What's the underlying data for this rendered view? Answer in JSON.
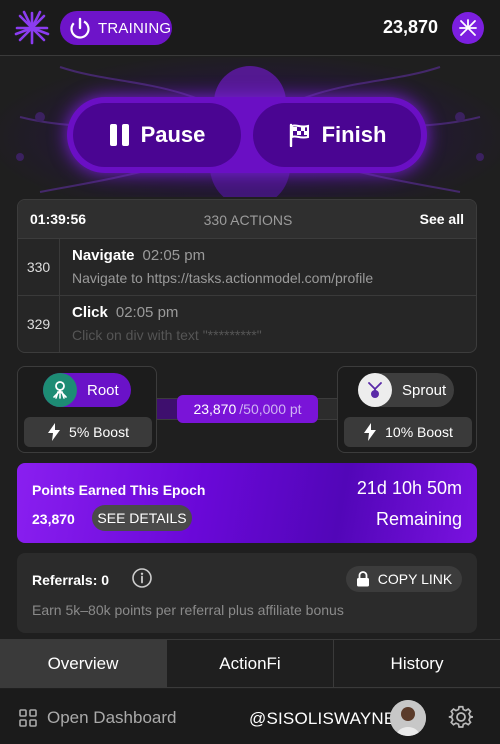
{
  "header": {
    "status_label": "TRAINING",
    "points": "23,870",
    "icons": [
      "logo-icon",
      "power-icon",
      "points-coin-icon"
    ]
  },
  "controls": {
    "pause_label": "Pause",
    "finish_label": "Finish"
  },
  "actions": {
    "timer": "01:39:56",
    "count_label": "330 ACTIONS",
    "see_all": "See all",
    "items": [
      {
        "num": "330",
        "name": "Navigate",
        "time": "02:05 pm",
        "desc": "Navigate to https://tasks.actionmodel.com/profile"
      },
      {
        "num": "329",
        "name": "Click",
        "time": "02:05 pm",
        "desc": "Click on div with text \"*********\""
      }
    ]
  },
  "tiers": {
    "current": {
      "name": "Root",
      "boost": "5% Boost"
    },
    "next": {
      "name": "Sprout",
      "boost": "10% Boost"
    },
    "progress": {
      "value_label": "23,870",
      "max_label": "/50,000 pt",
      "fraction": 0.4774
    }
  },
  "epoch": {
    "title": "Points Earned This Epoch",
    "points": "23,870",
    "details_label": "SEE DETAILS",
    "time_left": "21d 10h 50m",
    "remaining_label": "Remaining"
  },
  "referrals": {
    "title": "Referrals: 0",
    "copy_label": "COPY LINK",
    "description": "Earn 5k–80k points per referral plus affiliate bonus"
  },
  "tabs": [
    {
      "label": "Overview",
      "active": true
    },
    {
      "label": "ActionFi",
      "active": false
    },
    {
      "label": "History",
      "active": false
    }
  ],
  "footer": {
    "dashboard_label": "Open Dashboard",
    "handle": "@SISOLISWAYNE"
  },
  "colors": {
    "accent": "#6e14c9",
    "background": "#1f1f1f",
    "root_green": "#1d8c74"
  }
}
